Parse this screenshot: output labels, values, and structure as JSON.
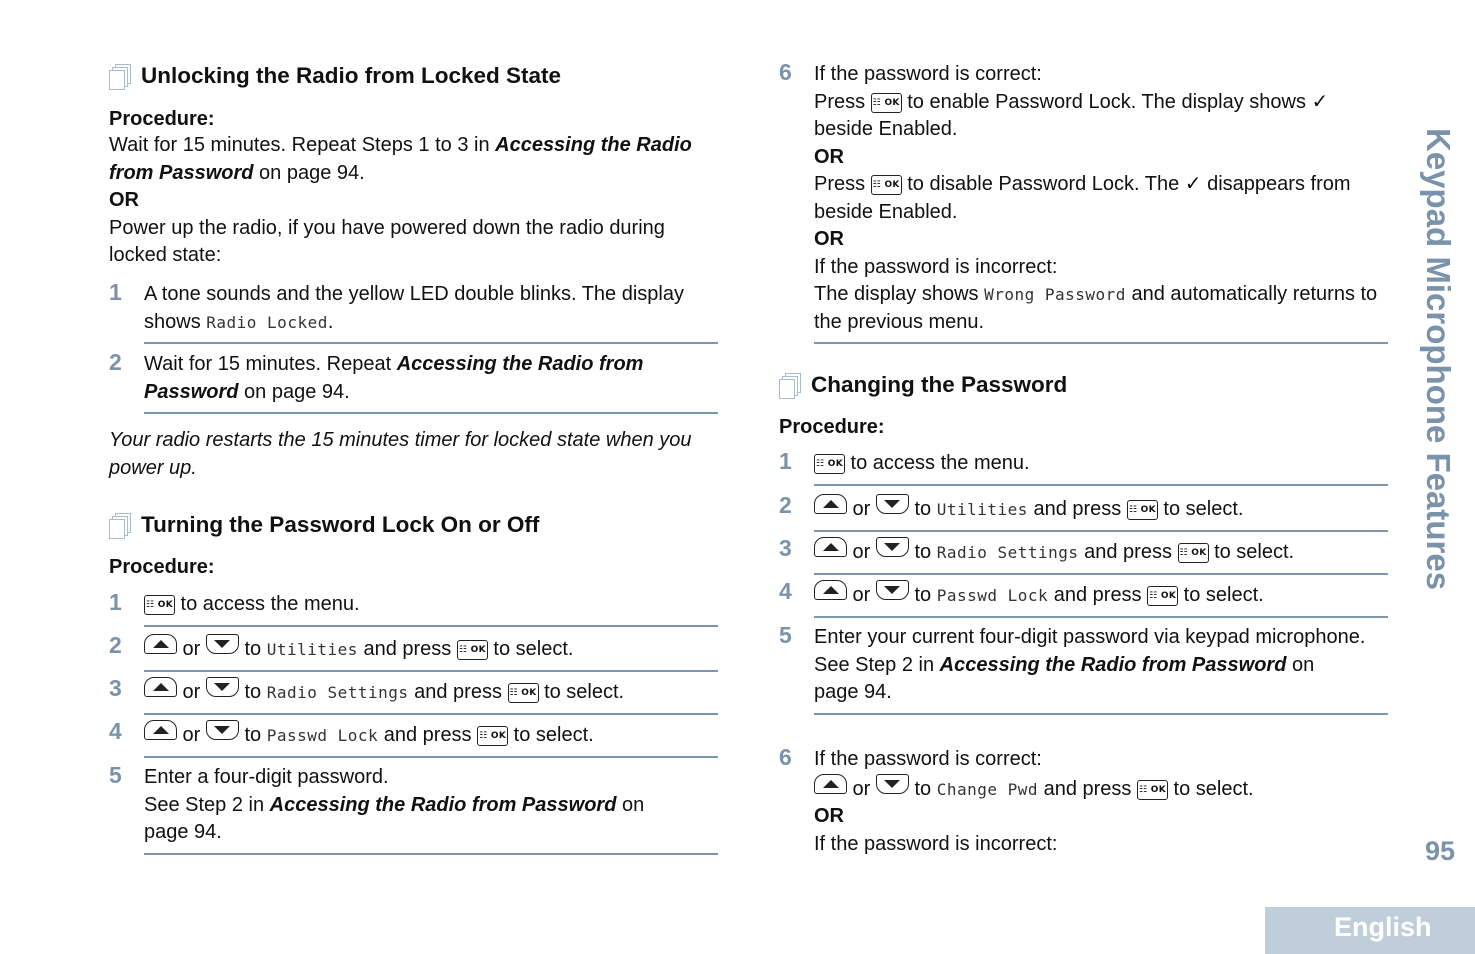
{
  "side_title": "Keypad Microphone Features",
  "page_number": "95",
  "language_tab": "English",
  "keys": {
    "ok": "OK",
    "menu_ok_icon": "menu-ok-key",
    "up_icon": "up-arrow-key",
    "down_icon": "down-arrow-key"
  },
  "common": {
    "procedure": "Procedure:",
    "or": "OR",
    "or_word": " or ",
    "to": " to ",
    "and_press": " and press ",
    "to_select": " to select.",
    "to_access_menu": " to access the menu.",
    "see_step_2_in": "See Step 2 in ",
    "accessing_link": "Accessing the Radio from Password",
    "on_page": " on page 94.",
    "on": " on",
    "page_94": "page 94."
  },
  "left": {
    "unlock": {
      "title": "Unlocking the Radio from Locked State",
      "intro_1": "Wait for 15 minutes. Repeat Steps 1 to 3 in ",
      "intro_link": "Accessing the Radio from Password",
      "intro_2": " on page 94.",
      "intro_or": "OR",
      "intro_power": "Power up the radio, if you have powered down the radio during locked state:",
      "steps": [
        {
          "num": "1",
          "text": "A tone sounds and the yellow LED double blinks. The display shows ",
          "display": "Radio Locked",
          "tail": "."
        },
        {
          "num": "2",
          "text": "Wait for 15 minutes. Repeat ",
          "link": "Accessing the Radio from Password",
          "tail": " on page 94."
        }
      ],
      "note": "Your radio restarts the 15 minutes timer for locked state when you power up."
    },
    "toggle": {
      "title": "Turning the Password Lock On or Off",
      "steps": [
        {
          "num": "1"
        },
        {
          "num": "2",
          "display": "Utilities"
        },
        {
          "num": "3",
          "display": "Radio Settings"
        },
        {
          "num": "4",
          "display": "Passwd Lock"
        },
        {
          "num": "5",
          "text": "Enter a four-digit password."
        }
      ]
    }
  },
  "right": {
    "toggle_step6": {
      "num": "6",
      "if_correct": "If the password is correct:",
      "press": "Press ",
      "enable_text": " to enable Password Lock. The display shows ✓ beside Enabled.",
      "disable_text": " to disable Password Lock. The ✓ disappears from beside Enabled.",
      "if_incorrect": "If the password is incorrect:",
      "wrong_pre": "The display shows ",
      "wrong_display": "Wrong Password",
      "wrong_post": " and automatically returns to the previous menu."
    },
    "change": {
      "title": "Changing the Password",
      "steps": [
        {
          "num": "1"
        },
        {
          "num": "2",
          "display": "Utilities"
        },
        {
          "num": "3",
          "display": "Radio Settings"
        },
        {
          "num": "4",
          "display": "Passwd Lock"
        },
        {
          "num": "5",
          "text": "Enter your current four-digit password via keypad microphone."
        },
        {
          "num": "6",
          "if_correct": "If the password is correct:",
          "display": "Change Pwd",
          "if_incorrect": "If the password is incorrect:"
        }
      ]
    }
  }
}
